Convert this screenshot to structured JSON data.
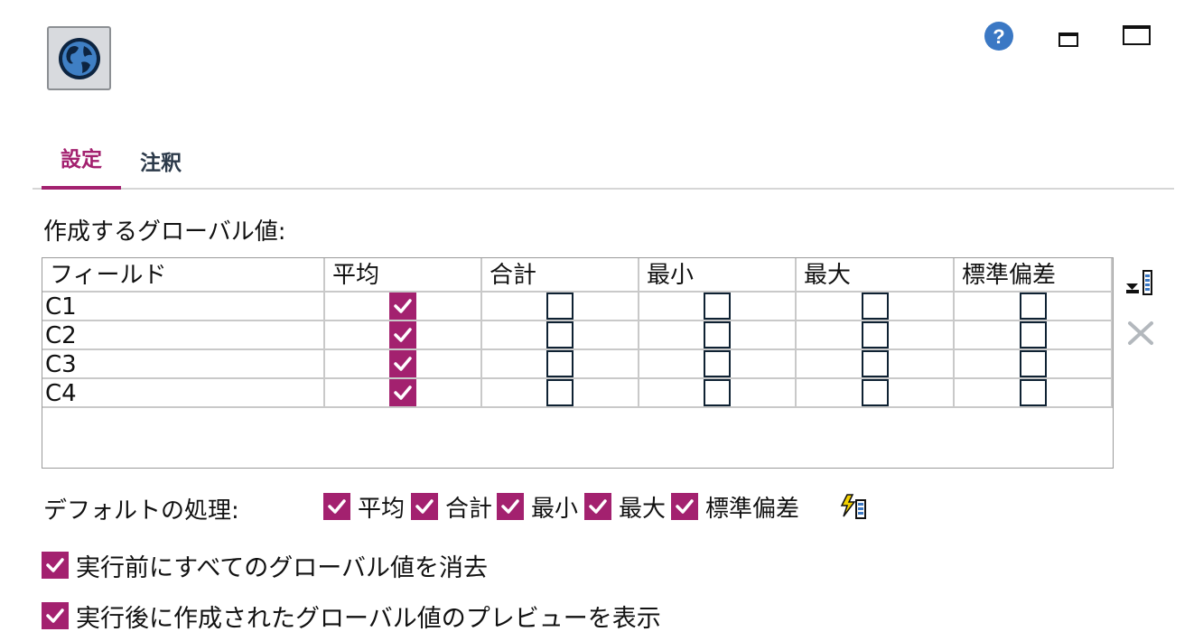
{
  "window": {
    "app_icon": "globe-icon",
    "controls": [
      "help-icon",
      "minimize-icon",
      "maximize-icon"
    ]
  },
  "tabs": [
    {
      "label": "設定",
      "active": true
    },
    {
      "label": "注釈",
      "active": false
    }
  ],
  "section_label": "作成するグローバル値:",
  "table": {
    "columns": [
      "フィールド",
      "平均",
      "合計",
      "最小",
      "最大",
      "標準偏差"
    ],
    "rows": [
      {
        "field": "C1",
        "checks": [
          true,
          false,
          false,
          false,
          false
        ]
      },
      {
        "field": "C2",
        "checks": [
          true,
          false,
          false,
          false,
          false
        ]
      },
      {
        "field": "C3",
        "checks": [
          true,
          false,
          false,
          false,
          false
        ]
      },
      {
        "field": "C4",
        "checks": [
          true,
          false,
          false,
          false,
          false
        ]
      }
    ]
  },
  "side_tools": [
    "add-column-icon",
    "delete-icon"
  ],
  "defaults": {
    "label": "デフォルトの処理:",
    "items": [
      {
        "label": "平均",
        "checked": true
      },
      {
        "label": "合計",
        "checked": true
      },
      {
        "label": "最小",
        "checked": true
      },
      {
        "label": "最大",
        "checked": true
      },
      {
        "label": "標準偏差",
        "checked": true
      }
    ],
    "tool_icon": "wand-icon"
  },
  "options": [
    {
      "label": "実行前にすべてのグローバル値を消去",
      "checked": true
    },
    {
      "label": "実行後に作成されたグローバル値のプレビューを表示",
      "checked": true
    }
  ],
  "colors": {
    "accent": "#a3216f",
    "tab_inactive": "#2c3a4a",
    "help_blue": "#3b78c4"
  }
}
